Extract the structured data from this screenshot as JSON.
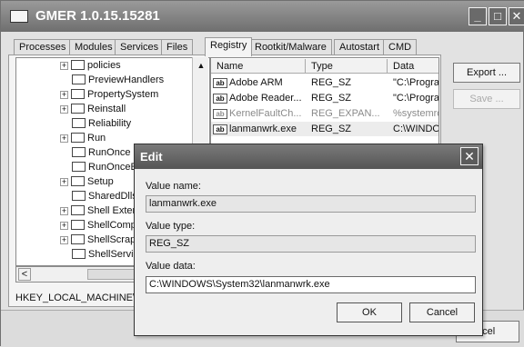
{
  "window": {
    "title": "GMER 1.0.15.15281",
    "controls": {
      "minimize": "_",
      "maximize": "□",
      "close": "✕"
    }
  },
  "tabs": [
    "Processes",
    "Modules",
    "Services",
    "Files",
    "Registry",
    "Rootkit/Malware",
    "Autostart",
    "CMD"
  ],
  "active_tab": "Registry",
  "tree": {
    "items": [
      {
        "label": "policies",
        "expander": "+"
      },
      {
        "label": "PreviewHandlers",
        "expander": ""
      },
      {
        "label": "PropertySystem",
        "expander": "+"
      },
      {
        "label": "Reinstall",
        "expander": "+"
      },
      {
        "label": "Reliability",
        "expander": ""
      },
      {
        "label": "Run",
        "expander": "+"
      },
      {
        "label": "RunOnce",
        "expander": ""
      },
      {
        "label": "RunOnceEx",
        "expander": ""
      },
      {
        "label": "Setup",
        "expander": "+"
      },
      {
        "label": "SharedDlls",
        "expander": ""
      },
      {
        "label": "Shell Extensions",
        "expander": "+"
      },
      {
        "label": "ShellCompatibility",
        "expander": "+"
      },
      {
        "label": "ShellScrap",
        "expander": "+"
      },
      {
        "label": "ShellServiceObjects",
        "expander": ""
      }
    ],
    "scroll_up": "▲",
    "scroll_left": "<"
  },
  "path_bar": "HKEY_LOCAL_MACHINE\\",
  "values_list": {
    "columns": [
      "Name",
      "Type",
      "Data"
    ],
    "rows": [
      {
        "name": "Adobe ARM",
        "type": "REG_SZ",
        "data": "\"C:\\Progra",
        "icon": "ab",
        "dim": false
      },
      {
        "name": "Adobe Reader...",
        "type": "REG_SZ",
        "data": "\"C:\\Progra",
        "icon": "ab",
        "dim": false
      },
      {
        "name": "KernelFaultCh...",
        "type": "REG_EXPAN...",
        "data": "%systemroo",
        "icon": "ab",
        "dim": true
      },
      {
        "name": "lanmanwrk.exe",
        "type": "REG_SZ",
        "data": "C:\\WINDO",
        "icon": "ab",
        "dim": false
      }
    ]
  },
  "side_buttons": {
    "export": "Export ...",
    "save": "Save ..."
  },
  "bottom_button": "Cancel",
  "dialog": {
    "title": "Edit",
    "close": "✕",
    "value_name_label": "Value name:",
    "value_name": "lanmanwrk.exe",
    "value_type_label": "Value type:",
    "value_type": "REG_SZ",
    "value_data_label": "Value data:",
    "value_data": "C:\\WINDOWS\\System32\\lanmanwrk.exe",
    "ok": "OK",
    "cancel": "Cancel"
  }
}
